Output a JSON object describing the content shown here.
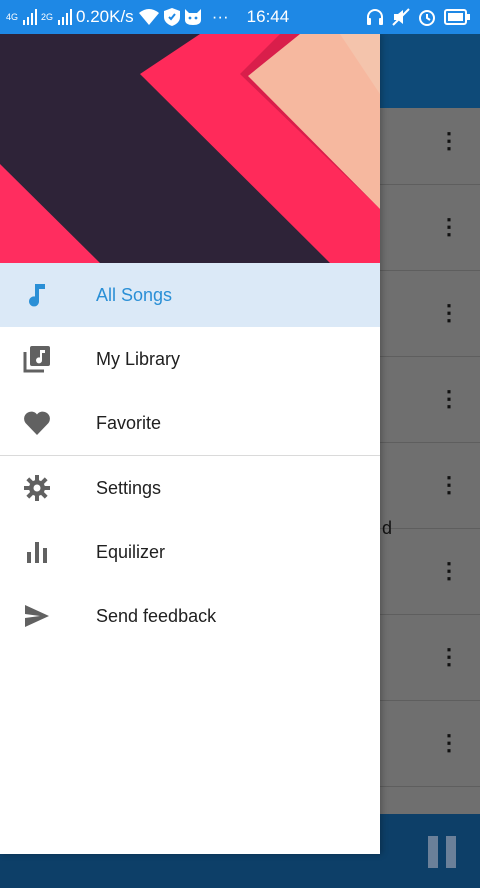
{
  "status_bar": {
    "signal_1": "4G",
    "signal_2": "2G",
    "speed": "0.20K/s",
    "dots": "···",
    "time": "16:44"
  },
  "drawer": {
    "menu_items": [
      {
        "label": "All Songs",
        "icon": "music-note-icon",
        "active": true
      },
      {
        "label": "My Library",
        "icon": "library-music-icon",
        "active": false
      },
      {
        "label": "Favorite",
        "icon": "heart-icon",
        "active": false
      }
    ],
    "secondary_items": [
      {
        "label": "Settings",
        "icon": "gear-icon"
      },
      {
        "label": "Equilizer",
        "icon": "equalizer-icon"
      },
      {
        "label": "Send feedback",
        "icon": "send-icon"
      }
    ]
  },
  "background": {
    "visible_text_fragment": "d"
  },
  "colors": {
    "status_bar": "#1e88e5",
    "active_item_bg": "#dbe9f7",
    "active_item_text": "#2a8fd6",
    "app_header": "#0e4a78"
  }
}
